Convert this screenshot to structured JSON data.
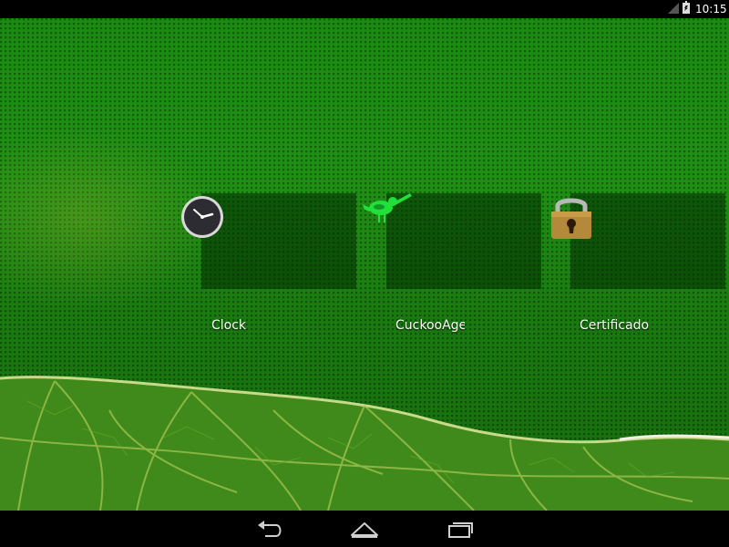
{
  "status_bar": {
    "time": "10:15"
  },
  "home_screen": {
    "apps": [
      {
        "label": "Clock",
        "icon": "clock-icon"
      },
      {
        "label": "CuckooAge",
        "icon": "bird-icon"
      },
      {
        "label": "Certificado",
        "icon": "padlock-icon"
      }
    ]
  },
  "navigation": {
    "buttons": [
      "back",
      "home",
      "recent-apps"
    ]
  },
  "colors": {
    "wallpaper_green": "#1f8f14",
    "bird_green": "#22e03a",
    "status_bar": "#000000"
  }
}
